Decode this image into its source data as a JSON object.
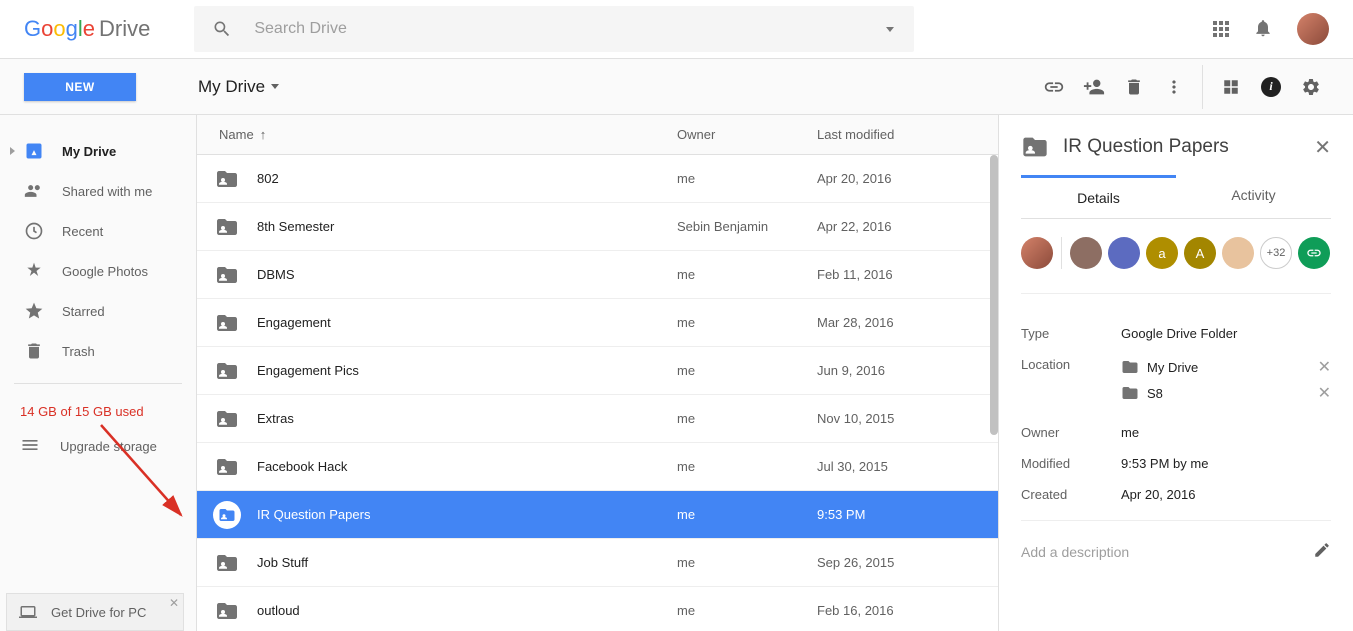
{
  "logo": {
    "product": "Drive"
  },
  "search": {
    "placeholder": "Search Drive"
  },
  "new_button": "NEW",
  "breadcrumb": "My Drive",
  "sidebar": {
    "items": [
      {
        "label": "My Drive"
      },
      {
        "label": "Shared with me"
      },
      {
        "label": "Recent"
      },
      {
        "label": "Google Photos"
      },
      {
        "label": "Starred"
      },
      {
        "label": "Trash"
      }
    ],
    "storage": "14 GB of 15 GB used",
    "upgrade": "Upgrade storage",
    "get_drive": "Get Drive for PC"
  },
  "columns": {
    "name": "Name",
    "owner": "Owner",
    "modified": "Last modified"
  },
  "files": [
    {
      "name": "802",
      "owner": "me",
      "modified": "Apr 20, 2016"
    },
    {
      "name": "8th Semester",
      "owner": "Sebin Benjamin",
      "modified": "Apr 22, 2016"
    },
    {
      "name": "DBMS",
      "owner": "me",
      "modified": "Feb 11, 2016"
    },
    {
      "name": "Engagement",
      "owner": "me",
      "modified": "Mar 28, 2016"
    },
    {
      "name": "Engagement Pics",
      "owner": "me",
      "modified": "Jun 9, 2016"
    },
    {
      "name": "Extras",
      "owner": "me",
      "modified": "Nov 10, 2015"
    },
    {
      "name": "Facebook Hack",
      "owner": "me",
      "modified": "Jul 30, 2015"
    },
    {
      "name": "IR Question Papers",
      "owner": "me",
      "modified": "9:53 PM",
      "selected": true
    },
    {
      "name": "Job Stuff",
      "owner": "me",
      "modified": "Sep 26, 2015"
    },
    {
      "name": "outloud",
      "owner": "me",
      "modified": "Feb 16, 2016"
    }
  ],
  "details": {
    "title": "IR Question Papers",
    "tabs": {
      "details": "Details",
      "activity": "Activity"
    },
    "avatars_more": "+32",
    "meta": {
      "type_label": "Type",
      "type_val": "Google Drive Folder",
      "location_label": "Location",
      "locations": [
        {
          "name": "My Drive"
        },
        {
          "name": "S8"
        }
      ],
      "owner_label": "Owner",
      "owner_val": "me",
      "modified_label": "Modified",
      "modified_val": "9:53 PM by me",
      "created_label": "Created",
      "created_val": "Apr 20, 2016"
    },
    "desc_placeholder": "Add a description"
  }
}
